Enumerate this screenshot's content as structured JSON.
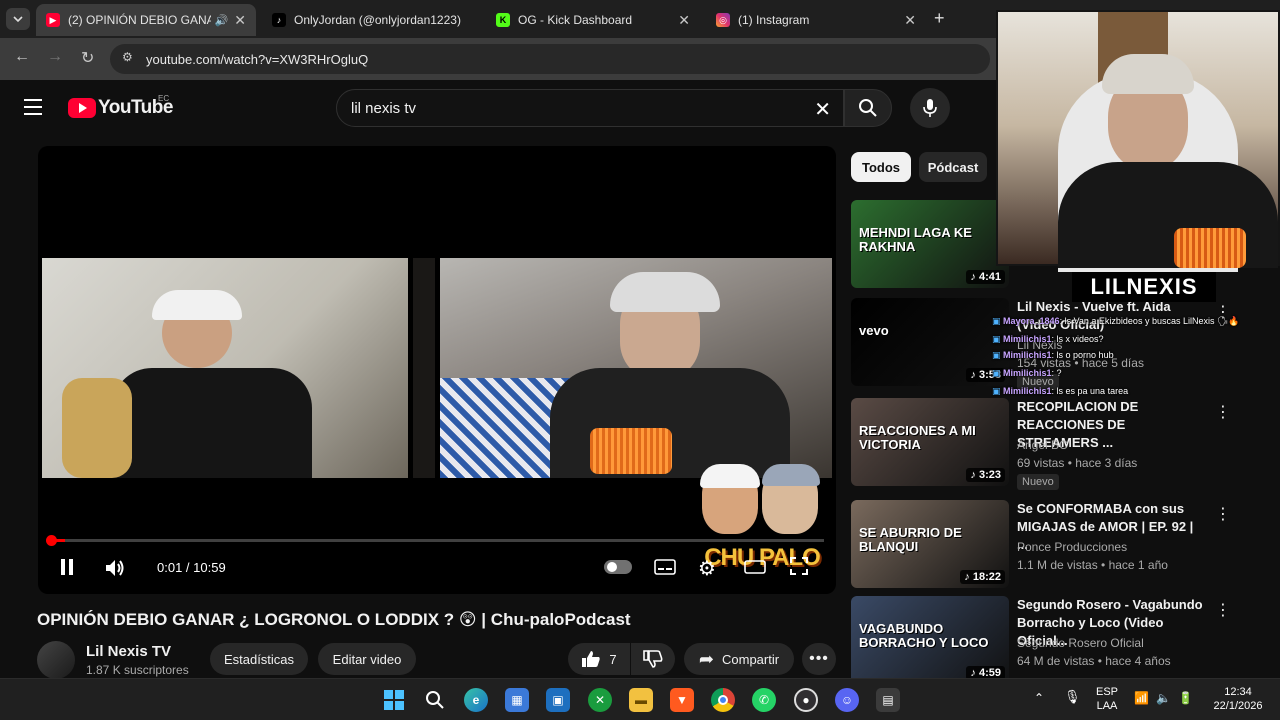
{
  "browser": {
    "tabs": [
      {
        "label": "(2) OPINIÓN DEBIO GANAR",
        "active": true,
        "icon": "youtube-icon"
      },
      {
        "label": "OnlyJordan (@onlyjordan1223)",
        "active": false,
        "icon": "tiktok-icon"
      },
      {
        "label": "OG - Kick Dashboard",
        "active": false,
        "icon": "kick-icon"
      },
      {
        "label": "(1) Instagram",
        "active": false,
        "icon": "instagram-icon"
      }
    ],
    "new_tab": "+",
    "url": "youtube.com/watch?v=XW3RHrOgluQ"
  },
  "youtube": {
    "logo_text": "YouTube",
    "region": "EC",
    "search_value": "lil nexis tv"
  },
  "player": {
    "time": "0:01 / 10:59",
    "progress_fraction": 0.002,
    "logo_text": "CHU PALO"
  },
  "video": {
    "title": "OPINIÓN DEBIO GANAR ¿ LOGRONOL O LODDIX ? 😲 | Chu-paloPodcast",
    "channel": "Lil Nexis TV",
    "subscribers": "1.87 K suscriptores",
    "stats_button": "Estadísticas",
    "edit_button": "Editar video",
    "likes": "7",
    "share_button": "Compartir"
  },
  "sidebar": {
    "chips": [
      "Todos",
      "Pódcast"
    ],
    "recommendations": [
      {
        "title": "",
        "channel": "",
        "meta": "",
        "duration": "4:41",
        "thumb_text": "MEHNDI LAGA KE RAKHNA",
        "thumb_color": "#2c6e2f"
      },
      {
        "title": "Lil Nexis - Vuelve ft. Aida (Video Oficial)",
        "channel": "Lil Nexis",
        "meta": "154 vistas • hace 5 días",
        "badge": "Nuevo",
        "duration": "3:58",
        "thumb_text": "vevo",
        "thumb_color": "#000000"
      },
      {
        "title": "RECOPILACION DE REACCIONES DE STREAMERS ...",
        "channel": "Angel BC",
        "meta": "69 vistas • hace 3 días",
        "badge": "Nuevo",
        "duration": "3:23",
        "thumb_text": "REACCIONES A MI VICTORIA",
        "thumb_color": "#5a4b45"
      },
      {
        "title": "Se CONFORMABA con sus MIGAJAS de AMOR | EP. 92 | ...",
        "channel": "Ponce Producciones",
        "meta": "1.1 M de vistas • hace 1 año",
        "badge": "",
        "duration": "18:22",
        "thumb_text": "SE ABURRIO DE BLANQUI",
        "thumb_color": "#7a6a5d"
      },
      {
        "title": "Segundo Rosero - Vagabundo Borracho y Loco (Video Oficial...",
        "channel": "Segundo Rosero Oficial",
        "meta": "64 M de vistas • hace 4 años",
        "badge": "",
        "duration": "4:59",
        "thumb_text": "VAGABUNDO BORRACHO Y LOCO",
        "thumb_color": "#3a4a66"
      }
    ]
  },
  "stream_overlay": {
    "name": "LILNEXIS",
    "chat": [
      {
        "user": "Mayora_1846",
        "text": ": ls Van a Ekizbideos y buscas LilNexis 🗣🔥"
      },
      {
        "user": "Mimilichis1",
        "text": ": ls x videos?"
      },
      {
        "user": "Mimilichis1",
        "text": ": ls o porno hub"
      },
      {
        "user": "Mimilichis1",
        "text": ": ?"
      },
      {
        "user": "Mimilichis1",
        "text": ": ls es pa una tarea"
      }
    ]
  },
  "taskbar": {
    "lang_top": "ESP",
    "lang_bottom": "LAA",
    "time": "12:34",
    "date": "22/1/2026"
  }
}
